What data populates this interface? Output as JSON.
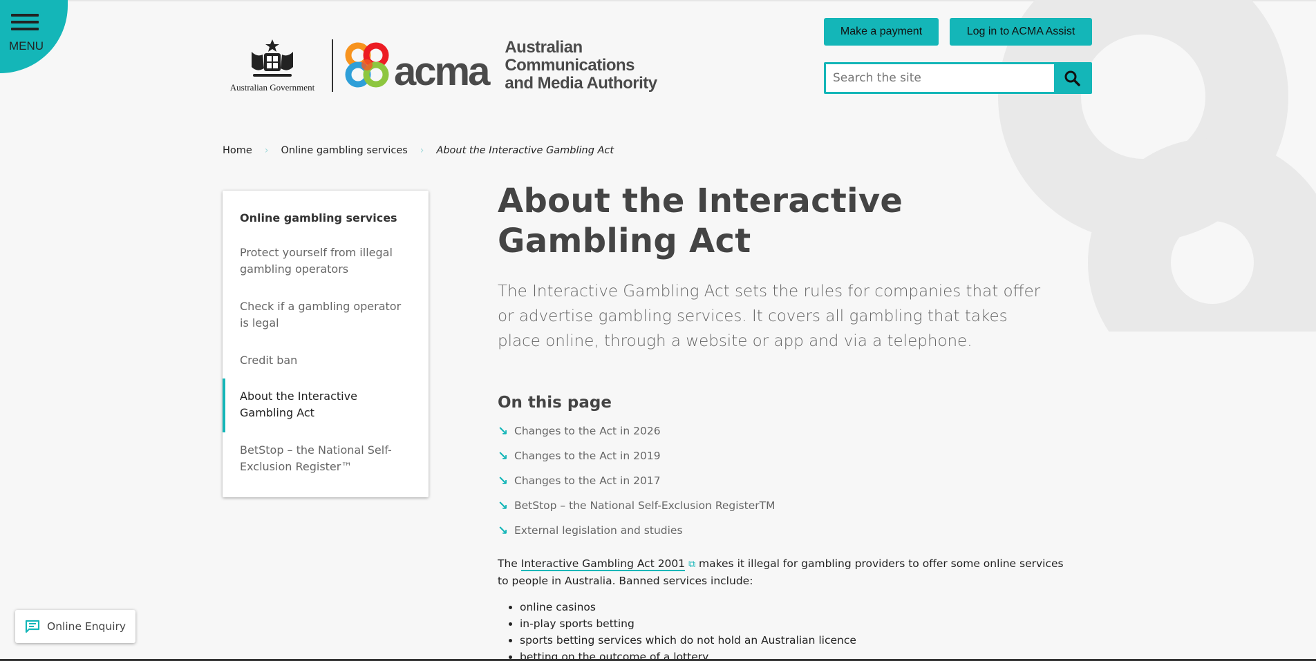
{
  "menu": {
    "label": "MENU"
  },
  "header": {
    "govt_text": "Australian Government",
    "acma_word": "acma",
    "acma_name_lines": [
      "Australian",
      "Communications",
      "and Media Authority"
    ],
    "pay_button": "Make a payment",
    "login_button": "Log in to ACMA Assist",
    "search_placeholder": "Search the site"
  },
  "breadcrumb": {
    "home": "Home",
    "section": "Online gambling services",
    "current": "About the Interactive Gambling Act"
  },
  "sidebar": {
    "heading": "Online gambling services",
    "items": [
      {
        "label": "Protect yourself from illegal gambling operators"
      },
      {
        "label": "Check if a gambling operator is legal"
      },
      {
        "label": "Credit ban"
      },
      {
        "label": "About the Interactive Gambling Act",
        "active": true
      },
      {
        "label": "BetStop – the National Self-Exclusion Register™"
      }
    ]
  },
  "main": {
    "title": "About the Interactive Gambling Act",
    "lead": "The Interactive Gambling Act sets the rules for companies that offer or advertise gambling services. It covers all gambling that takes place online, through a website or app and via a telephone.",
    "on_this_page": "On this page",
    "anchors": [
      "Changes to the Act in 2026",
      "Changes to the Act in 2019",
      "Changes to the Act in 2017",
      "BetStop – the National Self-Exclusion RegisterTM",
      "External legislation and studies"
    ],
    "para_prefix": "The ",
    "para_link": "Interactive Gambling Act 2001",
    "para_suffix": " makes it illegal for gambling providers to offer some online services to people in Australia. Banned services include:",
    "bullets": [
      "online casinos",
      "in-play sports betting",
      "sports betting services which do not hold an Australian licence",
      "betting on the outcome of a lottery"
    ]
  },
  "enquiry": {
    "label": "Online Enquiry"
  },
  "colors": {
    "accent": "#14b6b8",
    "text": "#333333",
    "background": "#f7f7f7"
  },
  "icons": [
    "menu-icon",
    "coat-of-arms-icon",
    "acma-logo-icon",
    "search-icon",
    "chevron-right-icon",
    "arrow-down-right-icon",
    "external-link-icon",
    "chat-icon"
  ]
}
